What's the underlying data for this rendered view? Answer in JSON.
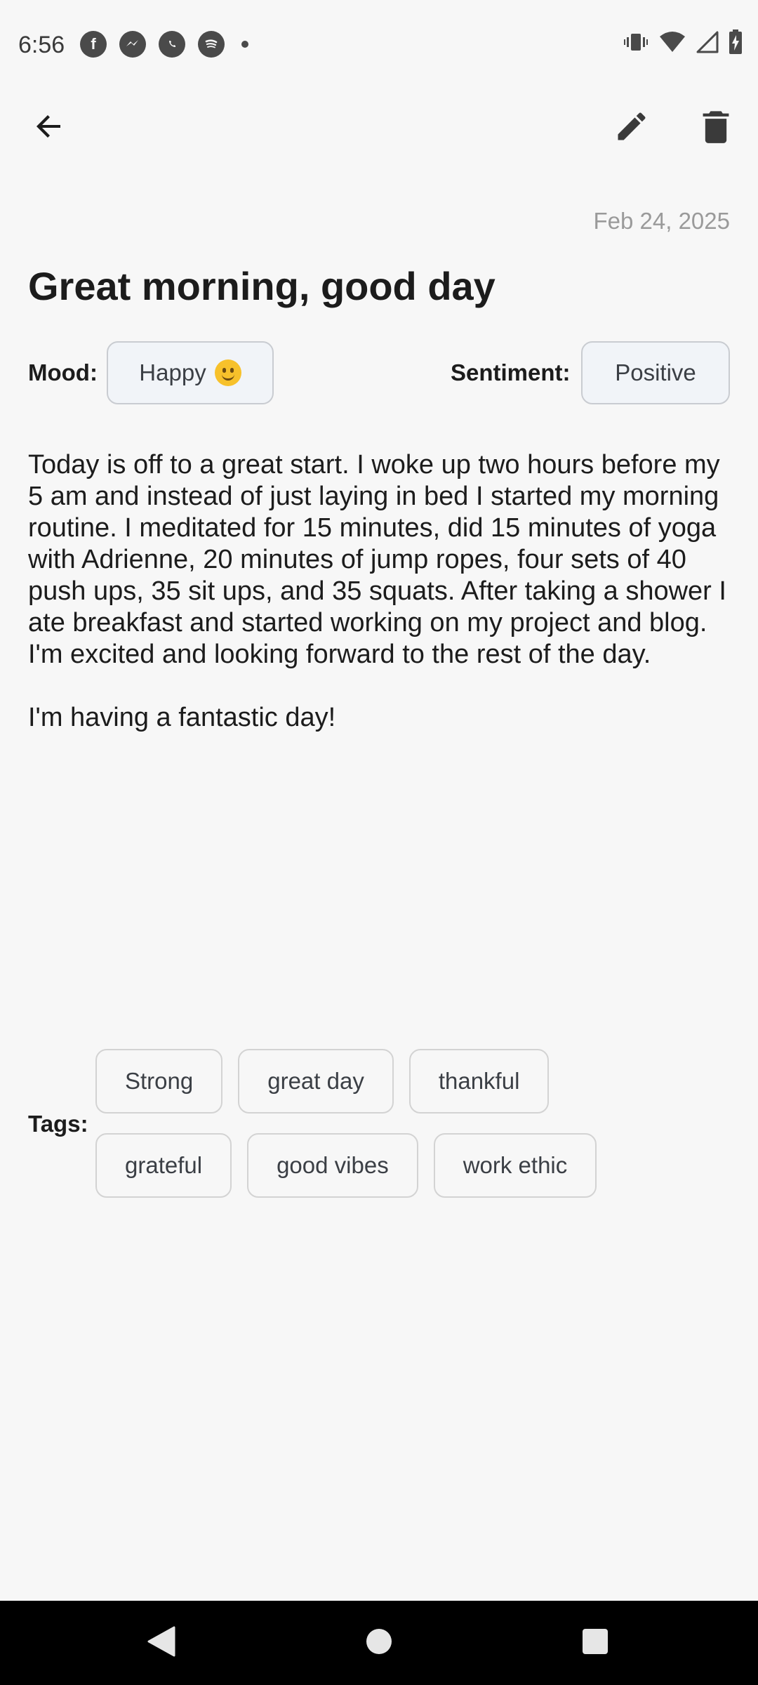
{
  "status_bar": {
    "time": "6:56",
    "app_icons": [
      "facebook-icon",
      "messenger-icon",
      "whatsapp-icon",
      "spotify-icon"
    ],
    "right_icons": [
      "vibrate-icon",
      "wifi-icon",
      "cell-signal-icon",
      "battery-charging-icon"
    ]
  },
  "app_bar": {
    "back_icon": "arrow-back-icon",
    "edit_icon": "pencil-icon",
    "delete_icon": "trash-icon"
  },
  "entry": {
    "date": "Feb 24, 2025",
    "title": "Great morning, good day",
    "mood_label": "Mood:",
    "mood_value": "Happy",
    "mood_emoji": "smiling-face-emoji",
    "sentiment_label": "Sentiment:",
    "sentiment_value": "Positive",
    "body_paragraphs": [
      "Today is off to a great start. I woke up two hours before my 5 am and instead of just laying in bed I started my morning routine. I meditated for 15 minutes, did 15 minutes of yoga with Adrienne, 20 minutes of jump ropes, four sets of 40 push ups, 35 sit ups, and 35 squats. After taking a shower I ate breakfast and started working on my project and blog. I'm excited and looking forward to the rest of the day.",
      "I'm having a fantastic day!"
    ],
    "tags_label": "Tags:",
    "tags": [
      "Strong",
      "great day",
      "thankful",
      "grateful",
      "good vibes",
      "work ethic"
    ]
  },
  "colors": {
    "background": "#f7f7f7",
    "chip_fill": "#f1f4f8",
    "chip_border": "#c9ccd1",
    "date_text": "#9a9a9a",
    "nav_bar": "#000000"
  }
}
